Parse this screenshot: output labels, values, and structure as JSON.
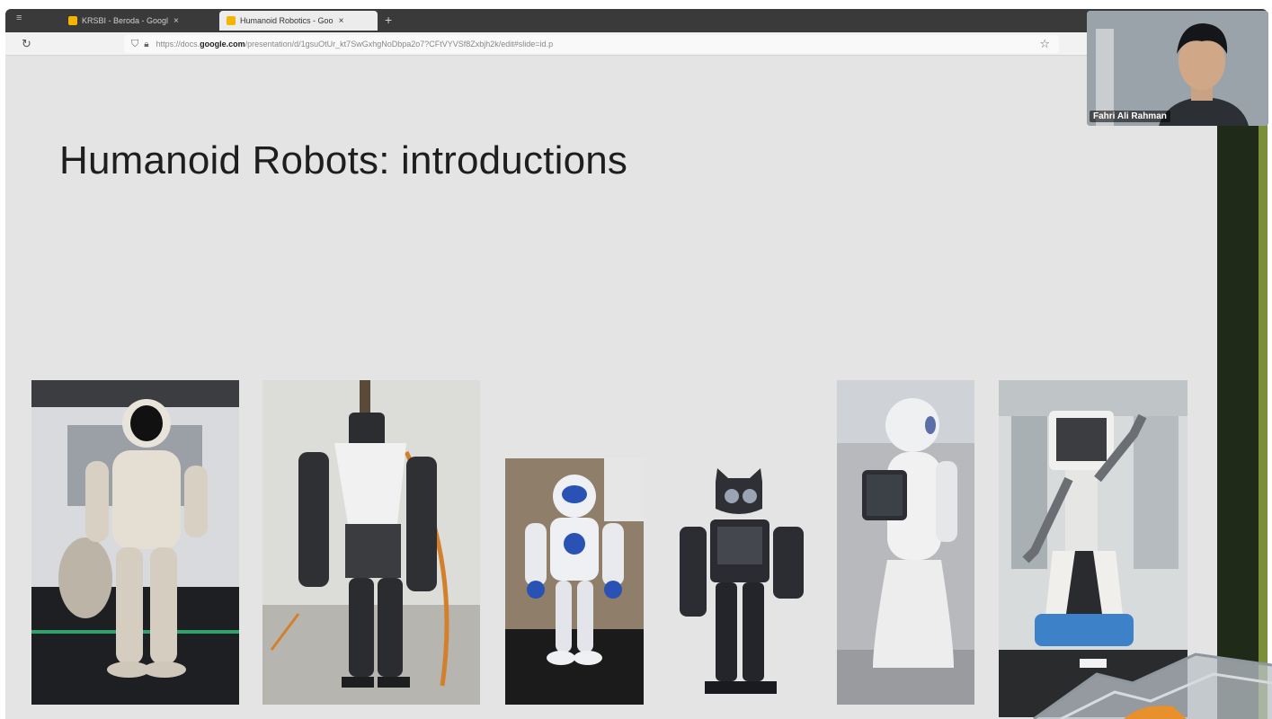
{
  "browser": {
    "tabs": [
      {
        "label": "KRSBI - Beroda - Googl",
        "active": false
      },
      {
        "label": "Humanoid Robotics - Goo",
        "active": true
      }
    ],
    "new_tab_label": "+",
    "url": {
      "prefix": "https://docs.",
      "domain": "google.com",
      "path": "/presentation/d/1gsuOtUr_kt7SwGxhgNoDbpa2o7?CFtVYVSf8Zxbjh2k/edit#slide=id.p"
    }
  },
  "slide": {
    "title": "Humanoid Robots: introductions",
    "photos": [
      {
        "name": "asimo-robot-photo",
        "icon": "white-humanoid-asimo"
      },
      {
        "name": "atlas-robot-photo",
        "icon": "hydraulic-humanoid-atlas"
      },
      {
        "name": "nao-robot-photo",
        "icon": "small-blue-white-humanoid-nao"
      },
      {
        "name": "darwin-robot-photo",
        "icon": "small-black-humanoid-darwin"
      },
      {
        "name": "pepper-robot-photo",
        "icon": "white-humanoid-pepper-with-tablet"
      },
      {
        "name": "service-robot-photo",
        "icon": "service-robot-with-screen-head"
      }
    ]
  },
  "webcam": {
    "participant_name": "Fahri Ali Rahman"
  },
  "colors": {
    "slide_background": "#e4e4e4",
    "tabbar": "#3a3a3a",
    "sidebar_accent": "#7a8f38"
  }
}
